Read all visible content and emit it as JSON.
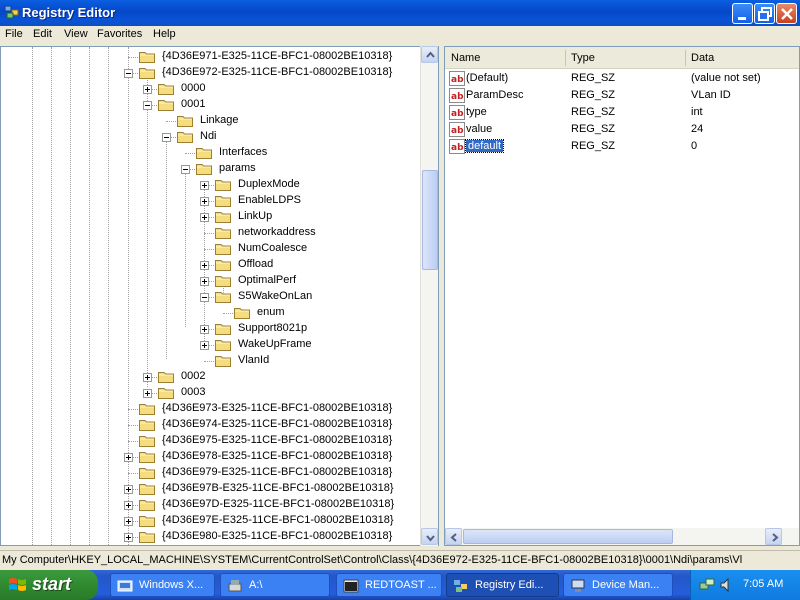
{
  "window": {
    "title": "Registry Editor"
  },
  "menu": [
    "File",
    "Edit",
    "View",
    "Favorites",
    "Help"
  ],
  "tree": {
    "items": [
      "{4D36E971-E325-11CE-BFC1-08002BE10318}",
      "{4D36E972-E325-11CE-BFC1-08002BE10318}",
      "0000",
      "0001",
      "Linkage",
      "Ndi",
      "Interfaces",
      "params",
      "DuplexMode",
      "EnableLDPS",
      "LinkUp",
      "networkaddress",
      "NumCoalesce",
      "Offload",
      "OptimalPerf",
      "S5WakeOnLan",
      "enum",
      "Support8021p",
      "WakeUpFrame",
      "VlanId",
      "0002",
      "0003",
      "{4D36E973-E325-11CE-BFC1-08002BE10318}",
      "{4D36E974-E325-11CE-BFC1-08002BE10318}",
      "{4D36E975-E325-11CE-BFC1-08002BE10318}",
      "{4D36E978-E325-11CE-BFC1-08002BE10318}",
      "{4D36E979-E325-11CE-BFC1-08002BE10318}",
      "{4D36E97B-E325-11CE-BFC1-08002BE10318}",
      "{4D36E97D-E325-11CE-BFC1-08002BE10318}",
      "{4D36E97E-E325-11CE-BFC1-08002BE10318}",
      "{4D36E980-E325-11CE-BFC1-08002BE10318}"
    ]
  },
  "values": {
    "columns": [
      "Name",
      "Type",
      "Data"
    ],
    "rows": [
      {
        "name": "(Default)",
        "type": "REG_SZ",
        "data": "(value not set)"
      },
      {
        "name": "ParamDesc",
        "type": "REG_SZ",
        "data": "VLan ID"
      },
      {
        "name": "type",
        "type": "REG_SZ",
        "data": "int"
      },
      {
        "name": "value",
        "type": "REG_SZ",
        "data": "24"
      },
      {
        "name": "default",
        "type": "REG_SZ",
        "data": "0"
      }
    ]
  },
  "status": {
    "path": "My Computer\\HKEY_LOCAL_MACHINE\\SYSTEM\\CurrentControlSet\\Control\\Class\\{4D36E972-E325-11CE-BFC1-08002BE10318}\\0001\\Ndi\\params\\Vl"
  },
  "taskbar": {
    "start": "start",
    "tasks": [
      "Windows X...",
      "A:\\",
      "REDTOAST ...",
      "Registry Edi...",
      "Device Man..."
    ],
    "clock": "7:05 AM"
  },
  "colors": {
    "titlebar": "#0a5fe0",
    "selection": "#316ac5",
    "start": "#3d9a3d"
  }
}
